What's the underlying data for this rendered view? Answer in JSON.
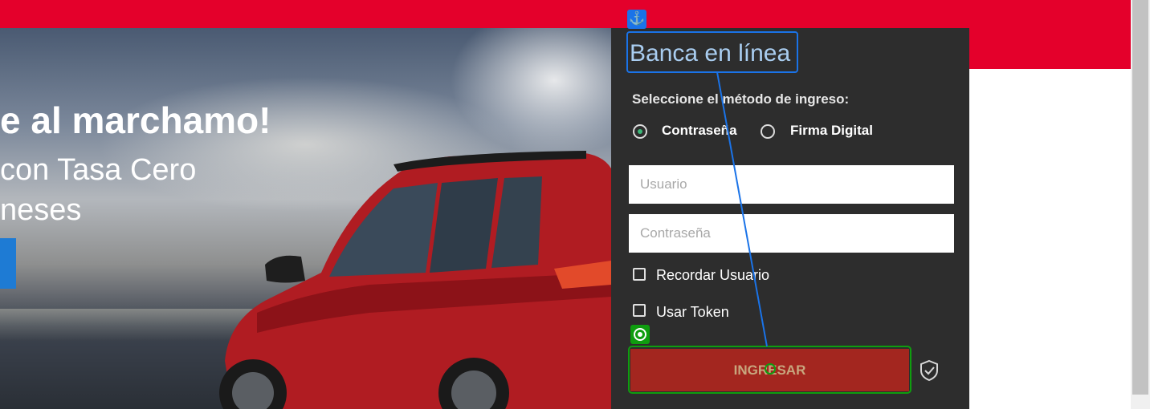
{
  "hero": {
    "title": "e al marchamo!",
    "subtitle_line1": "con Tasa Cero",
    "subtitle_line2": "neses"
  },
  "login": {
    "title": "Banca en línea",
    "method_label": "Seleccione el método de ingreso:",
    "methods": [
      {
        "label": "Contraseña",
        "selected": true
      },
      {
        "label": "Firma Digital",
        "selected": false
      }
    ],
    "username_placeholder": "Usuario",
    "password_placeholder": "Contraseña",
    "remember_label": "Recordar Usuario",
    "token_label": "Usar Token",
    "submit_label": "INGRESAR"
  },
  "colors": {
    "brand_red": "#e4002b",
    "panel_bg": "#2d2d2d",
    "submit_bg": "#a3261f",
    "radio_selected": "#3cb878",
    "annotation_blue": "#1a73e8",
    "annotation_green": "#0f9d0f"
  },
  "icons": {
    "anchor": "anchor-icon",
    "target": "target-icon",
    "shield": "shield-check-icon"
  }
}
